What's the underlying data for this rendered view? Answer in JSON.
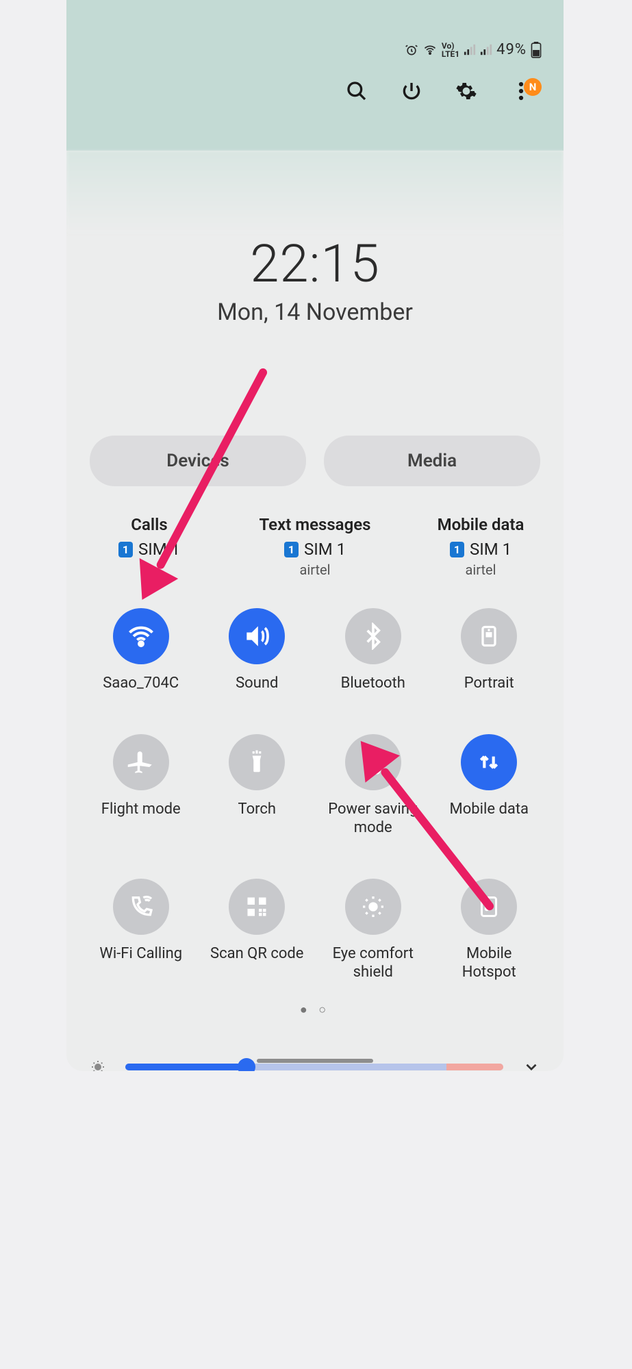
{
  "status": {
    "battery": "49%",
    "badge": "N"
  },
  "clock": {
    "time": "22:15",
    "date": "Mon, 14 November"
  },
  "tabs": {
    "device": "Devices",
    "media": "Media"
  },
  "sim": {
    "calls": {
      "title": "Calls",
      "sim": "SIM 1",
      "carrier": ""
    },
    "texts": {
      "title": "Text messages",
      "sim": "SIM 1",
      "carrier": "airtel"
    },
    "data": {
      "title": "Mobile data",
      "sim": "SIM 1",
      "carrier": "airtel"
    }
  },
  "tiles": [
    {
      "label": "Saao_704C",
      "active": true
    },
    {
      "label": "Sound",
      "active": true
    },
    {
      "label": "Bluetooth",
      "active": false
    },
    {
      "label": "Portrait",
      "active": false
    },
    {
      "label": "Flight mode",
      "active": false
    },
    {
      "label": "Torch",
      "active": false
    },
    {
      "label": "Power saving mode",
      "active": false
    },
    {
      "label": "Mobile data",
      "active": true
    },
    {
      "label": "Wi-Fi Calling",
      "active": false
    },
    {
      "label": "Scan QR code",
      "active": false
    },
    {
      "label": "Eye comfort shield",
      "active": false
    },
    {
      "label": "Mobile Hotspot",
      "active": false
    }
  ],
  "sim_chip": "1"
}
